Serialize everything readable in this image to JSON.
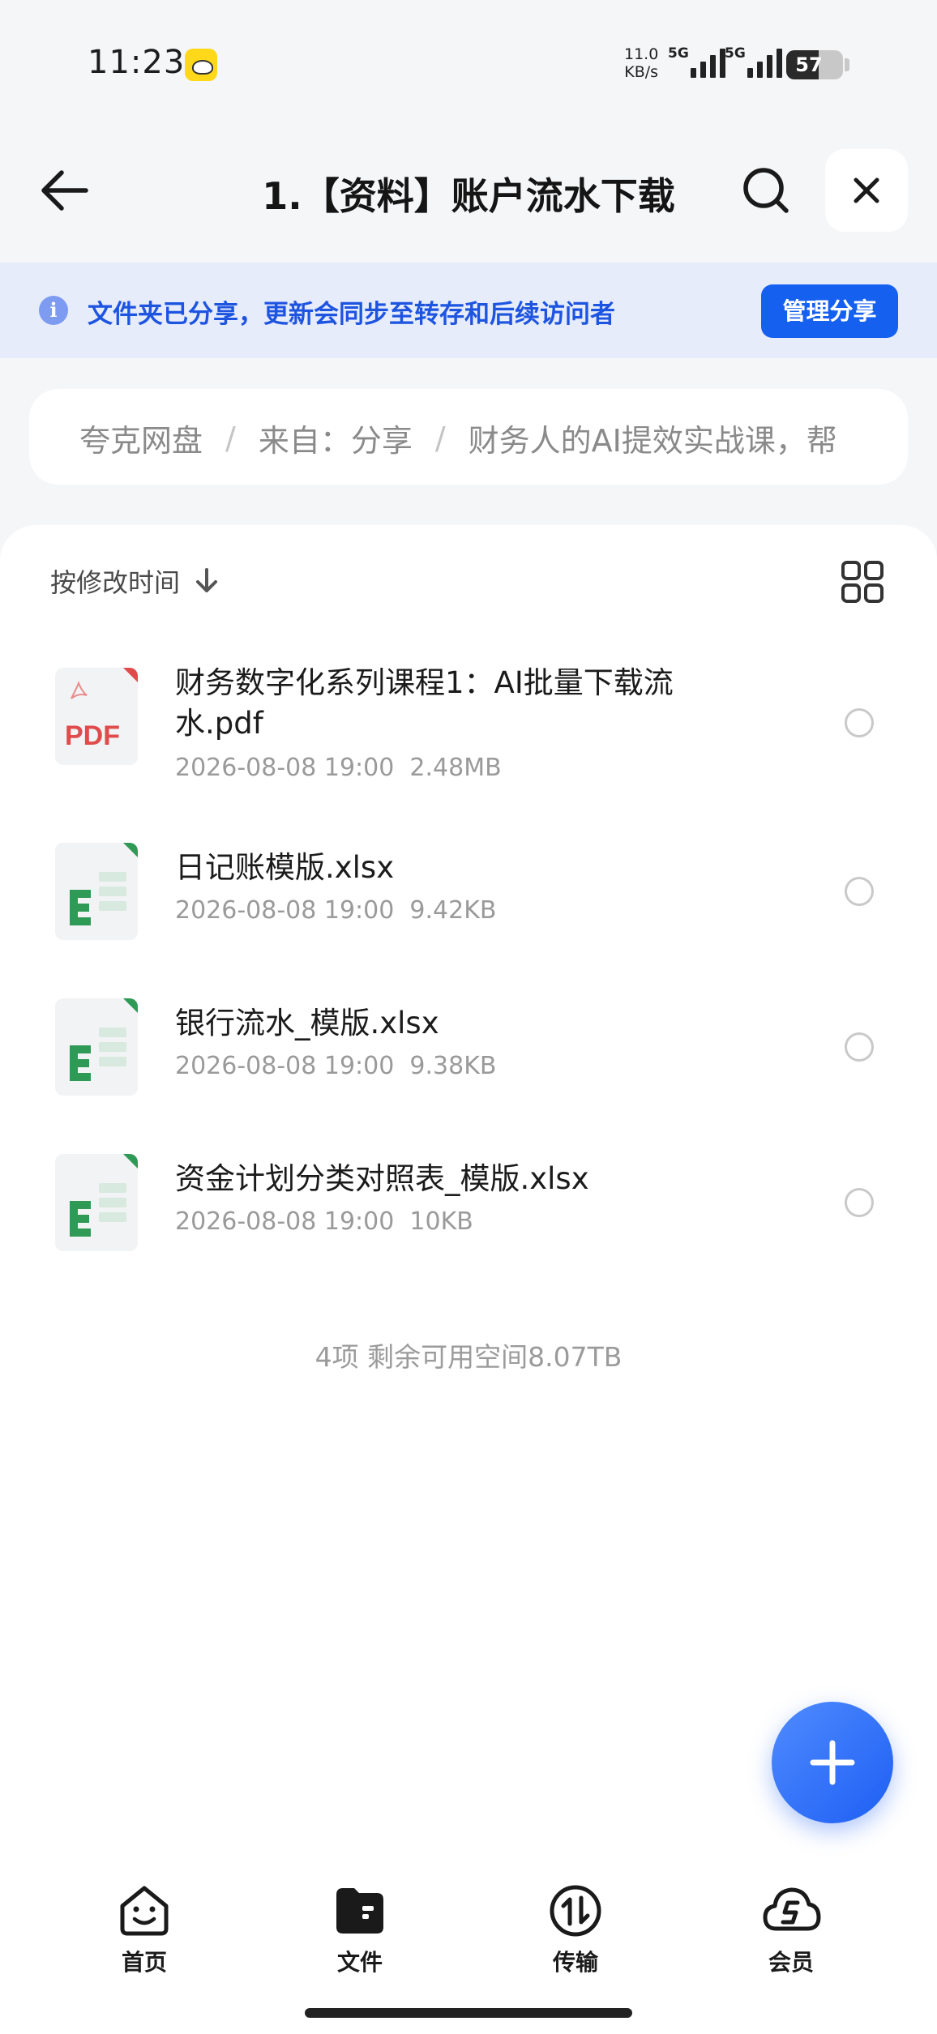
{
  "status_bar": {
    "time": "11:23",
    "net_speed_value": "11.0",
    "net_speed_unit": "KB/s",
    "signal_1_label": "5G",
    "signal_2_label": "5G",
    "battery_level": "57",
    "battery_percent": 57
  },
  "header": {
    "title": "1.【资料】账户流水下载",
    "back_icon": "arrow-left-icon",
    "search_icon": "search-icon",
    "close_icon": "close-icon"
  },
  "share_banner": {
    "text": "文件夹已分享，更新会同步至转存和后续访问者",
    "button_label": "管理分享"
  },
  "breadcrumb": {
    "items": [
      "夸克网盘",
      "来自：分享",
      "财务人的AI提效实战课，帮"
    ]
  },
  "toolbar": {
    "sort_label": "按修改时间",
    "view_toggle_icon": "grid-view-icon"
  },
  "files": [
    {
      "name": "财务数字化系列课程1：AI批量下载流水.pdf",
      "date": "2026-08-08 19:00",
      "size": "2.48MB",
      "type": "pdf",
      "type_label": "PDF"
    },
    {
      "name": "日记账模版.xlsx",
      "date": "2026-08-08 19:00",
      "size": "9.42KB",
      "type": "xlsx"
    },
    {
      "name": "银行流水_模版.xlsx",
      "date": "2026-08-08 19:00",
      "size": "9.38KB",
      "type": "xlsx"
    },
    {
      "name": "资金计划分类对照表_模版.xlsx",
      "date": "2026-08-08 19:00",
      "size": "10KB",
      "type": "xlsx"
    }
  ],
  "summary": "4项 剩余可用空间8.07TB",
  "bottom_nav": {
    "items": [
      {
        "label": "首页",
        "icon": "home-smile-icon",
        "active": false
      },
      {
        "label": "文件",
        "icon": "folder-icon",
        "active": true
      },
      {
        "label": "传输",
        "icon": "transfer-icon",
        "active": false
      },
      {
        "label": "会员",
        "icon": "member-cloud-icon",
        "active": false
      }
    ]
  },
  "colors": {
    "accent": "#1660f0",
    "banner_bg": "#e7ecfb",
    "banner_text": "#1d54e0",
    "xlsx_green": "#2e9a56",
    "pdf_red": "#e04b4b"
  }
}
